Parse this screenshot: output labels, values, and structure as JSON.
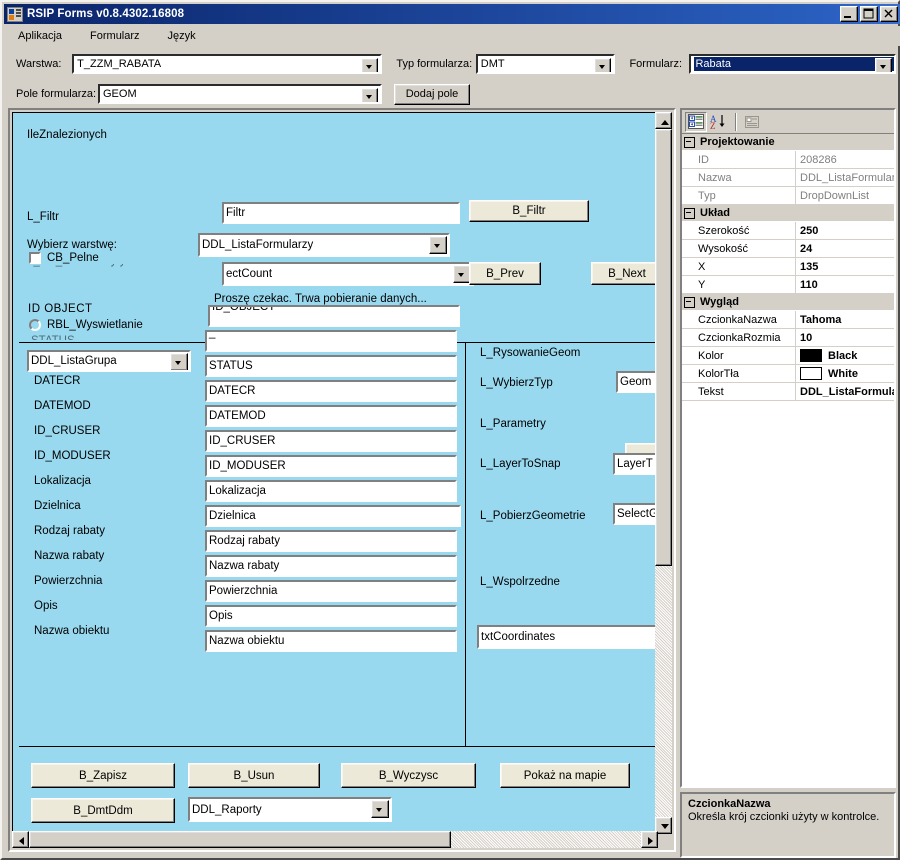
{
  "window": {
    "title": "RSIP Forms v0.8.4302.16808",
    "icon": "app-form-icon",
    "buttons": {
      "minimize": "_",
      "maximize": "□",
      "close": "×"
    }
  },
  "menu": {
    "items": [
      "Aplikacja",
      "Formularz",
      "Język"
    ]
  },
  "toolbar": {
    "warstwa_label": "Warstwa:",
    "warstwa_value": "T_ZZM_RABATA",
    "typ_label": "Typ formularza:",
    "typ_value": "DMT",
    "formularz_label": "Formularz:",
    "formularz_value": "Rabata",
    "pole_label": "Pole formularza:",
    "pole_value": "GEOM",
    "dodaj_pole_label": "Dodaj pole"
  },
  "designer": {
    "title_label": "IleZnalezionych",
    "labels": {
      "l_filtr": "L_Filtr",
      "wybierz_warstwe": "Wybierz warstwę:",
      "cb_pelne": "CB_Pelne",
      "hidden_behind_cb": "L_CB_Pelne ukryty",
      "id_object": "ID  OBJECT",
      "rbl_wyswietlanie": "RBL_Wyswietlanie",
      "datecr": "DATECR",
      "datemod": "DATEMOD",
      "id_cruser": "ID_CRUSER",
      "id_moduser": "ID_MODUSER",
      "lokalizacja": "Lokalizacja",
      "dzielnica": "Dzielnica",
      "rodzaj_rabaty": "Rodzaj rabaty",
      "nazwa_rabaty": "Nazwa rabaty",
      "powierzchnia": "Powierzchnia",
      "opis": "Opis",
      "nazwa_obiektu": "Nazwa obiektu",
      "l_rysowaniegeom": "L_RysowanieGeom",
      "l_wybierztyp": "L_WybierzTyp",
      "l_parametry": "L_Parametry",
      "l_layertosnap": "L_LayerToSnap",
      "l_pobierzgeometrie": "L_PobierzGeometrie",
      "l_wspolrzedne": "L_Wspolrzedne",
      "status_hidden": "STATUS"
    },
    "fields": {
      "filtr": "Filtr",
      "ddl_listaformularzy": "DDL_ListaFormularzy",
      "selectcount": "ectCount",
      "wait_message": "Proszę czekac. Trwa pobieranie danych...",
      "id_object_field": "ID_OBJECT",
      "ddl_listagrupa": "DDL_ListaGrupa",
      "status": "STATUS",
      "datecr": "DATECR",
      "datemod": "DATEMOD",
      "id_cruser": "ID_CRUSER",
      "id_moduser": "ID_MODUSER",
      "lokalizacja": "Lokalizacja",
      "dzielnica": "Dzielnica",
      "rodzaj_rabaty": "Rodzaj rabaty",
      "nazwa_rabaty": "Nazwa rabaty",
      "powierzchnia": "Powierzchnia",
      "opis": "Opis",
      "nazwa_obiektu": "Nazwa obiektu",
      "geom_type": "Geom",
      "layer_to_snap": "LayerT",
      "select_geom": "SelectG",
      "txt_coordinates": "txtCoordinates",
      "ddl_raporty": "DDL_Raporty"
    },
    "buttons": {
      "b_filtr": "B_Filtr",
      "b_prev": "B_Prev",
      "b_next": "B_Next",
      "b_zapisz": "B_Zapisz",
      "b_usun": "B_Usun",
      "b_wyczysc": "B_Wyczysc",
      "pokaz_na_mapie": "Pokaż na mapie",
      "b_dmtddm": "B_DmtDdm"
    }
  },
  "property_grid": {
    "toolbar": {
      "categorized": "categorized-view-icon",
      "alphabetical": "alphabetical-sort-icon",
      "property_pages": "property-pages-icon"
    },
    "categories": [
      {
        "name": "Projektowanie",
        "rows": [
          {
            "key": "ID",
            "value": "208286",
            "dim": true
          },
          {
            "key": "Nazwa",
            "value": "DDL_ListaFormularzy",
            "dim": true
          },
          {
            "key": "Typ",
            "value": "DropDownList",
            "dim": true
          }
        ]
      },
      {
        "name": "Układ",
        "rows": [
          {
            "key": "Szerokość",
            "value": "250",
            "dim": false
          },
          {
            "key": "Wysokość",
            "value": "24",
            "dim": false
          },
          {
            "key": "X",
            "value": "135",
            "dim": false
          },
          {
            "key": "Y",
            "value": "110",
            "dim": false
          }
        ]
      },
      {
        "name": "Wygląd",
        "rows": [
          {
            "key": "CzcionkaNazwa",
            "value": "Tahoma",
            "dim": false
          },
          {
            "key": "CzcionkaRozmia",
            "value": "10",
            "dim": false
          },
          {
            "key": "Kolor",
            "value": "Black",
            "dim": false,
            "swatch": "#000000"
          },
          {
            "key": "KolorTła",
            "value": "White",
            "dim": false,
            "swatch": "#ffffff"
          },
          {
            "key": "Tekst",
            "value": "DDL_ListaFormularz",
            "dim": false
          }
        ]
      }
    ],
    "description": {
      "title": "CzcionkaNazwa",
      "text": "Określa krój czcionki użyty w kontrolce."
    }
  },
  "colors": {
    "form_background": "#99d9ef",
    "chrome": "#d4d0c8",
    "titlebar": "#0a246a",
    "button_face": "#ece9d8"
  }
}
